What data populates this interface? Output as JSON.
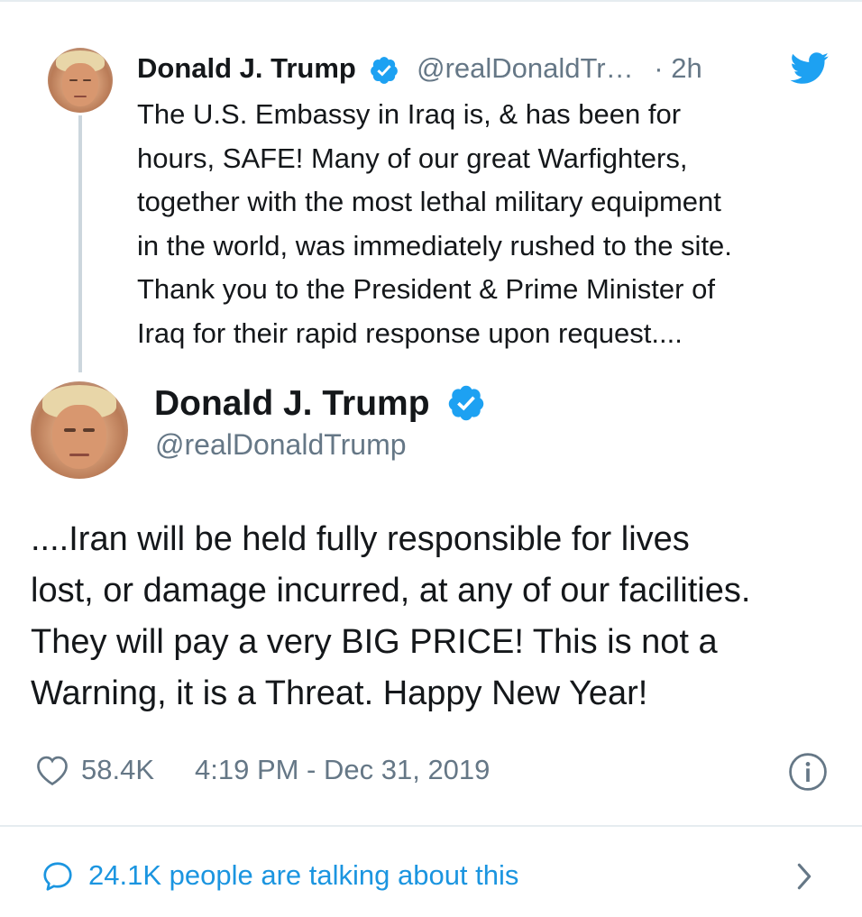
{
  "tweet_quoted": {
    "display_name": "Donald J. Trump",
    "handle": "@realDonaldTr…",
    "separator": "·",
    "time": "2h",
    "text_lines": [
      "The U.S. Embassy in Iraq is, & has been for",
      "hours, SAFE! Many of our great Warfighters,",
      "together with the most lethal military equipment",
      "in the world, was immediately rushed to the site.",
      "Thank you to the President & Prime Minister of",
      "Iraq for their rapid response upon request...."
    ]
  },
  "tweet_main": {
    "display_name": "Donald J. Trump",
    "handle": "@realDonaldTrump",
    "text_lines": [
      "....Iran will be held fully responsible for lives",
      "lost, or damage incurred, at any of our facilities.",
      "They will pay a very BIG PRICE! This is not a",
      "Warning, it is a Threat. Happy New Year!"
    ],
    "likes": "58.4K",
    "timestamp": "4:19 PM - Dec 31, 2019"
  },
  "conversation": {
    "label": "24.1K people are talking about this"
  },
  "icons": {
    "verified": "verified-badge-icon",
    "bird": "twitter-bird-icon",
    "heart": "heart-icon",
    "info": "info-icon",
    "comment": "comment-icon",
    "chevron": "chevron-right-icon"
  },
  "colors": {
    "accent": "#1da1f2",
    "link": "#1b95e0",
    "text": "#14171a",
    "secondary": "#657786",
    "divider": "#e6ecf0"
  }
}
